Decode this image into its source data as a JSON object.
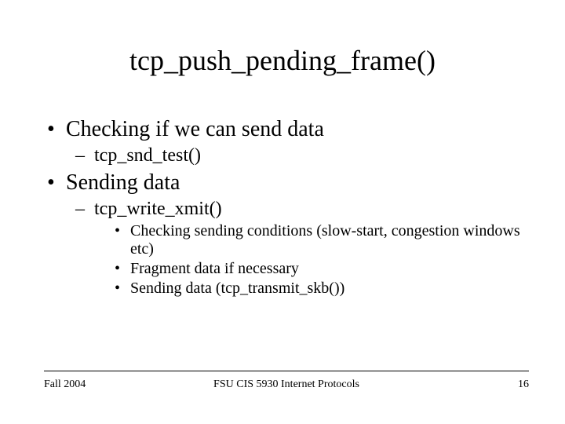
{
  "title": "tcp_push_pending_frame()",
  "bullets": {
    "b1": "Checking if we can send data",
    "b1_1": "tcp_snd_test()",
    "b2": "Sending data",
    "b2_1": "tcp_write_xmit()",
    "b2_1_1": "Checking sending conditions (slow-start, congestion windows etc)",
    "b2_1_2": "Fragment data if necessary",
    "b2_1_3": "Sending data (tcp_transmit_skb())"
  },
  "footer": {
    "left": "Fall 2004",
    "center": "FSU CIS 5930 Internet Protocols",
    "right": "16"
  }
}
